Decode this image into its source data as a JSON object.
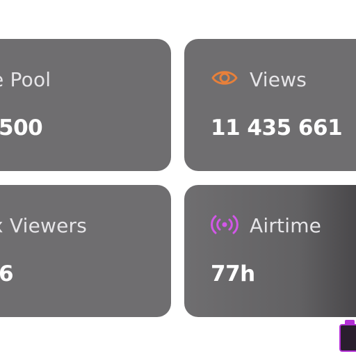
{
  "cards": {
    "top_left": {
      "label": "e Pool",
      "value": "500"
    },
    "top_right": {
      "label": "Views",
      "value": "11 435 661",
      "icon": "eye-icon",
      "icon_color": "#e8803a"
    },
    "bottom_left": {
      "label": "x Viewers",
      "value": "6"
    },
    "bottom_right": {
      "label": "Airtime",
      "value": "77h",
      "icon": "broadcast-icon",
      "icon_color": "#d257e8"
    }
  },
  "colors": {
    "card_bg": "#6f6e70",
    "text": "#f0eff1",
    "accent_orange": "#e8803a",
    "accent_purple": "#d257e8"
  }
}
